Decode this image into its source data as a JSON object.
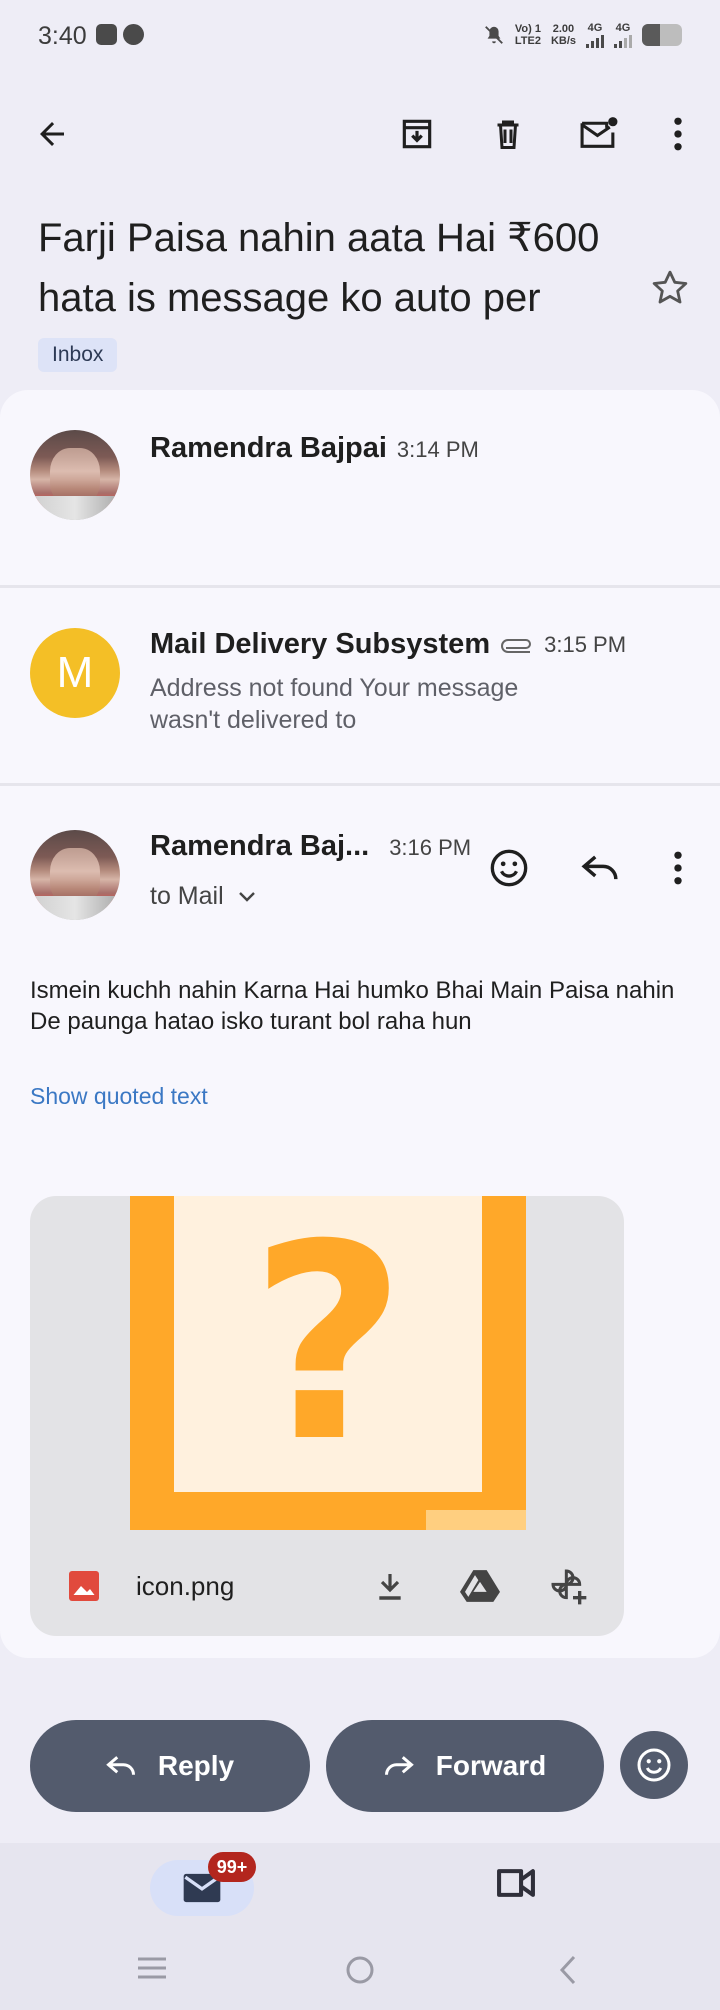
{
  "status_bar": {
    "time": "3:40",
    "network_1": "Vo) 1\nLTE2",
    "speed": "2.00\nKB/s",
    "net_4g_a": "4G",
    "net_4g_b": "4G"
  },
  "toolbar": {
    "back_icon": "arrow-left-icon",
    "archive_icon": "archive-icon",
    "delete_icon": "trash-icon",
    "mark_unread_icon": "mail-unread-icon",
    "more_icon": "more-vertical-icon"
  },
  "subject": "Farji Paisa nahin aata Hai ₹600 hata is message ko auto per",
  "label": "Inbox",
  "thread": [
    {
      "sender": "Ramendra Bajpai",
      "time": "3:14 PM"
    },
    {
      "avatar_letter": "M",
      "sender": "Mail Delivery Subsystem",
      "time": "3:15 PM",
      "snippet": "Address not found Your message wasn't delivered to"
    },
    {
      "sender": "Ramendra Baj...",
      "time": "3:16 PM",
      "recipient": "to Mail",
      "body": "Ismein kuchh nahin Karna Hai humko Bhai Main Paisa nahin De paunga hatao isko turant bol raha hun",
      "show_quoted": "Show quoted text",
      "attachment": {
        "filename": "icon.png",
        "preview_glyph": "?"
      }
    }
  ],
  "actions": {
    "reply": "Reply",
    "forward": "Forward"
  },
  "bottom_nav": {
    "mail_badge": "99+"
  },
  "colors": {
    "accent_blue": "#3b78c4",
    "button_bg": "#535b6d",
    "avatar_m": "#f4bf26",
    "badge": "#b3261e",
    "attachment_orange": "#ffa829"
  }
}
